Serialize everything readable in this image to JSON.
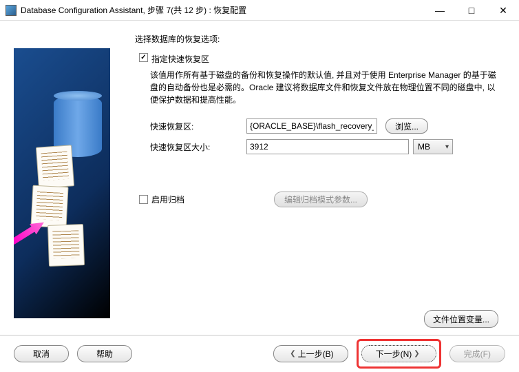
{
  "title": "Database Configuration Assistant, 步骤 7(共 12 步) : 恢复配置",
  "content": {
    "section_title": "选择数据库的恢复选项:",
    "specify_fra_checkbox": "指定快速恢复区",
    "fra_description": "该值用作所有基于磁盘的备份和恢复操作的默认值, 并且对于使用 Enterprise Manager 的基于磁盘的自动备份也是必需的。Oracle 建议将数据库文件和恢复文件放在物理位置不同的磁盘中, 以便保护数据和提高性能。",
    "fra_label": "快速恢复区:",
    "fra_value": "{ORACLE_BASE}\\flash_recovery_area",
    "browse_label": "浏览...",
    "fra_size_label": "快速恢复区大小:",
    "fra_size_value": "3912",
    "fra_size_unit": "MB",
    "archive_checkbox": "启用归档",
    "edit_archive_params": "编辑归档模式参数...",
    "file_location_vars": "文件位置变量..."
  },
  "buttons": {
    "cancel": "取消",
    "help": "帮助",
    "back": "上一步(B)",
    "next": "下一步(N)",
    "finish": "完成(F)"
  }
}
